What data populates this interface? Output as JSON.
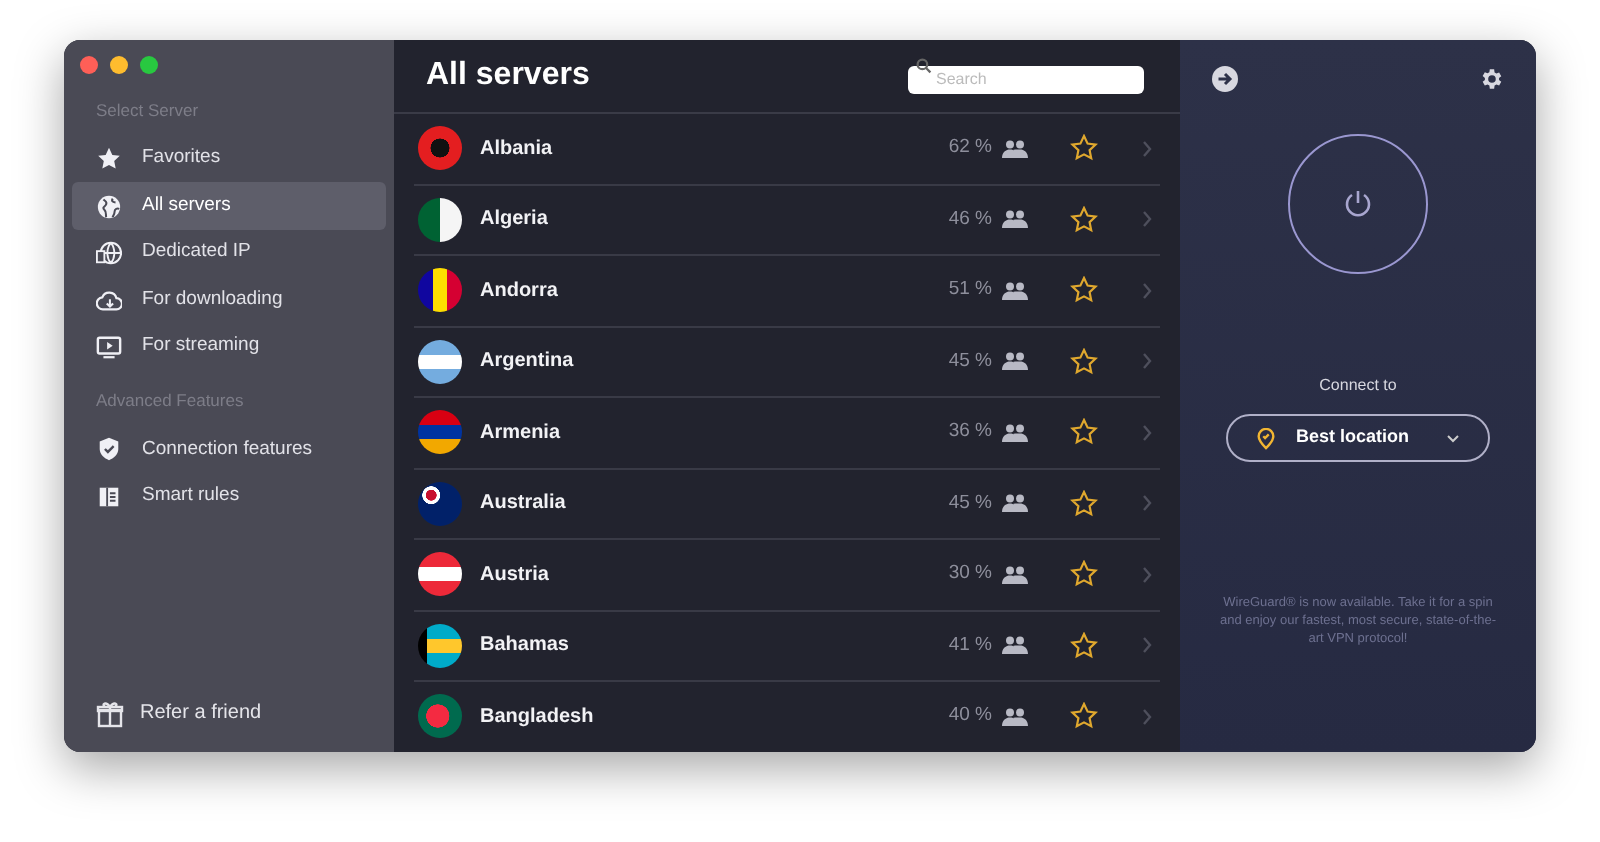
{
  "sidebar": {
    "sections": [
      {
        "title": "Select Server",
        "items": [
          {
            "label": "Favorites",
            "selected": false
          },
          {
            "label": "All servers",
            "selected": true
          },
          {
            "label": "Dedicated IP",
            "selected": false
          },
          {
            "label": "For downloading",
            "selected": false
          },
          {
            "label": "For streaming",
            "selected": false
          }
        ]
      },
      {
        "title": "Advanced Features",
        "items": [
          {
            "label": "Connection features",
            "selected": false
          },
          {
            "label": "Smart rules",
            "selected": false
          }
        ]
      }
    ],
    "footer": "Refer a friend"
  },
  "list": {
    "title": "All servers",
    "search": {
      "placeholder": "Search"
    },
    "rows": [
      {
        "name": "Albania",
        "load": "62 %",
        "favorite": false
      },
      {
        "name": "Algeria",
        "load": "46 %",
        "favorite": false
      },
      {
        "name": "Andorra",
        "load": "51 %",
        "favorite": false
      },
      {
        "name": "Argentina",
        "load": "45 %",
        "favorite": false
      },
      {
        "name": "Armenia",
        "load": "36 %",
        "favorite": false
      },
      {
        "name": "Australia",
        "load": "45 %",
        "favorite": false
      },
      {
        "name": "Austria",
        "load": "30 %",
        "favorite": false
      },
      {
        "name": "Bahamas",
        "load": "41 %",
        "favorite": false
      },
      {
        "name": "Bangladesh",
        "load": "40 %",
        "favorite": false
      }
    ]
  },
  "connect": {
    "label": "Connect to",
    "location": "Best location",
    "notice": "WireGuard® is now available. Take it for a spin and enjoy our fastest, most secure, state-of-the-art VPN protocol!"
  }
}
